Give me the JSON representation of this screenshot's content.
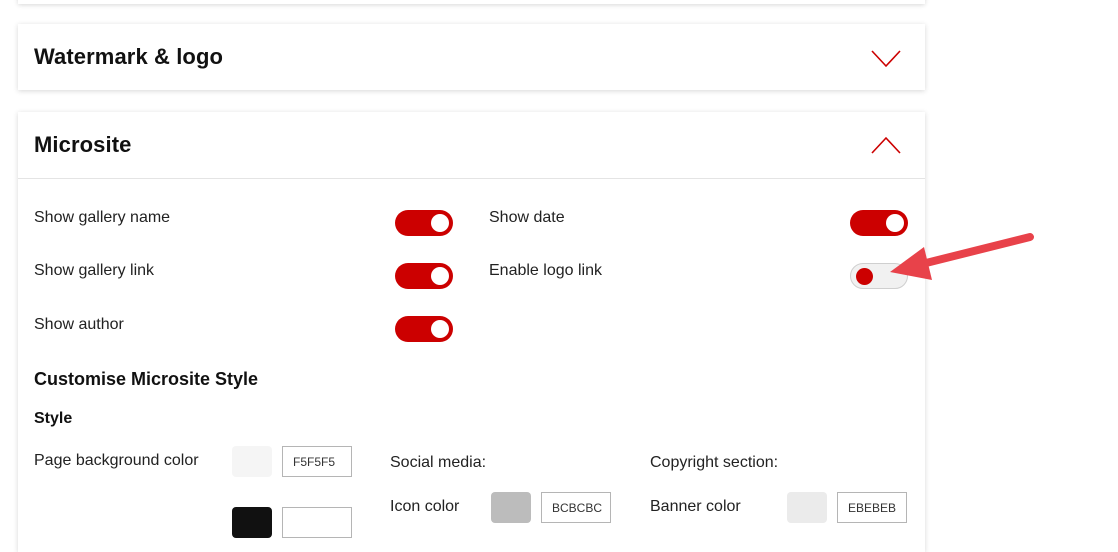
{
  "panels": {
    "watermark": {
      "title": "Watermark & logo",
      "expanded": false
    },
    "microsite": {
      "title": "Microsite",
      "expanded": true
    }
  },
  "toggles": {
    "show_gallery_name": {
      "label": "Show gallery name",
      "on": true
    },
    "show_gallery_link": {
      "label": "Show gallery link",
      "on": true
    },
    "show_author": {
      "label": "Show author",
      "on": true
    },
    "show_date": {
      "label": "Show date",
      "on": true
    },
    "enable_logo_link": {
      "label": "Enable logo link",
      "on": false
    }
  },
  "customise": {
    "heading": "Customise Microsite Style",
    "style_heading": "Style",
    "page_background": {
      "label": "Page background color",
      "hex": "F5F5F5",
      "color": "#f5f5f5"
    },
    "second_row": {
      "color": "#111111"
    },
    "social_media": {
      "heading": "Social media:",
      "icon_color": {
        "label": "Icon color",
        "hex": "BCBCBC",
        "color": "#bcbcbc"
      }
    },
    "copyright": {
      "heading": "Copyright section:",
      "banner_color": {
        "label": "Banner color",
        "hex": "EBEBEB",
        "color": "#ebebeb"
      }
    }
  },
  "colors": {
    "accent": "#cc0000",
    "annotation_arrow": "#e8424a"
  }
}
